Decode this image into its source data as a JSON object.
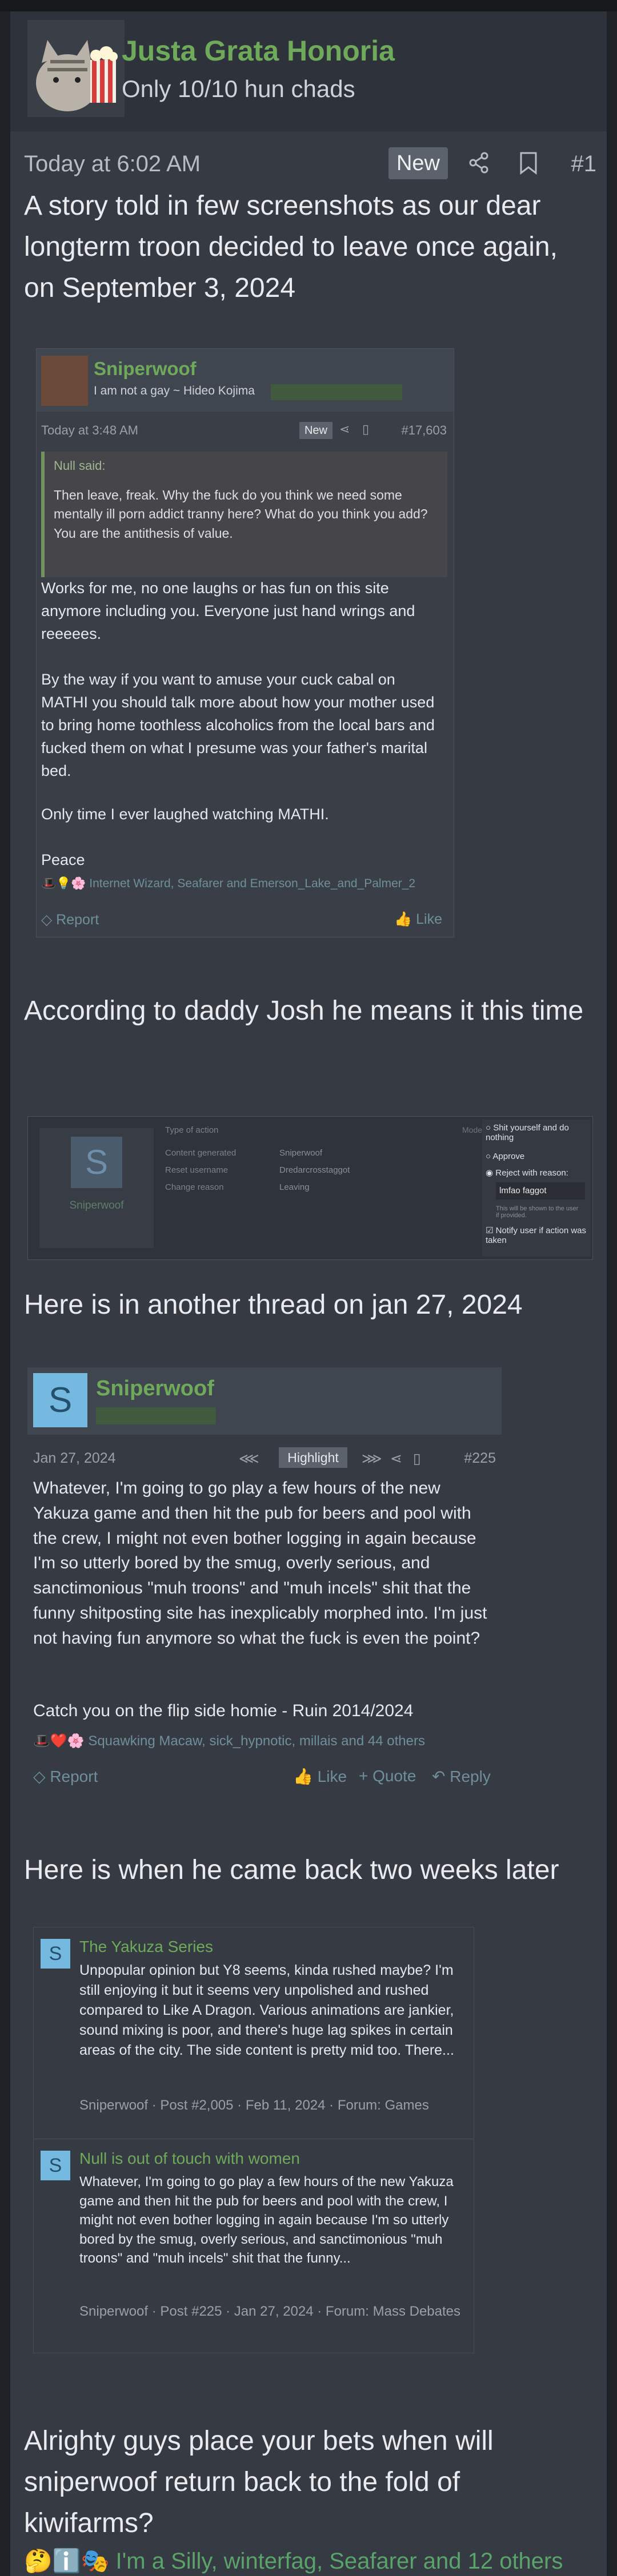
{
  "header": {
    "username": "Justa Grata Honoria",
    "user_title": "Only 10/10 hun chads",
    "timestamp": "Today at 6:02 AM",
    "badge": "New",
    "post_number": "#1",
    "icons": [
      "share-icon",
      "bookmark-icon"
    ]
  },
  "post": {
    "intro": "A story told in few screenshots as our dear longterm troon decided to leave once again, on September 3, 2024",
    "caption2": "According to daddy Josh he means it this time",
    "caption3": "Here is in another thread on jan 27, 2024",
    "caption4": "Here is when he came back two weeks later",
    "outro": "Alrighty guys place your bets when will sniperwoof return back to the fold of kiwifarms?",
    "reactions": "I'm a Silly, winterfag, Seafarer and 12 others"
  },
  "shot1": {
    "username": "Sniperwoof",
    "title": "I am not a gay ~ Hideo Kojima",
    "timestamp": "Today at 3:48 AM",
    "badge": "New",
    "post_number": "#17,603",
    "quote_label": "Null said:",
    "quote_text": "Then leave, freak. Why the fuck do you think we need some mentally ill porn addict tranny here? What do you think you add? You are the antithesis of value.",
    "para1": "Works for me, no one laughs or has fun on this site anymore including you. Everyone just hand wrings and reeeees.",
    "para2": "By the way if you want to amuse your cuck cabal on MATHI you should talk more about how your mother used to bring home toothless alcoholics from the local bars and fucked them on what I presume was your father's marital bed.",
    "para3": "Only time I ever laughed watching MATHI.",
    "para4": "Peace",
    "reactions": "Internet Wizard, Seafarer and Emerson_Lake_and_Palmer_2",
    "report": "Report",
    "like": "Like"
  },
  "shot2": {
    "avatar_letter": "S",
    "username": "Sniperwoof",
    "rows": [
      {
        "label": "Type of action",
        "value": ""
      },
      {
        "label": "Content generated",
        "value": "Sniperwoof"
      },
      {
        "label": "Reset username",
        "value": "Dredarcrosstaggot"
      },
      {
        "label": "Change reason",
        "value": "Leaving"
      }
    ],
    "right_header": "Moderate action",
    "options": [
      {
        "label": "Shit yourself and do nothing",
        "checked": false
      },
      {
        "label": "Approve",
        "checked": false
      },
      {
        "label": "Reject with reason:",
        "checked": true
      }
    ],
    "reason_value": "lmfao faggot",
    "note": "This will be shown to the user if provided.",
    "notify": "Notify user if action was taken"
  },
  "shot3": {
    "avatar_letter": "S",
    "username": "Sniperwoof",
    "timestamp": "Jan 27, 2024",
    "highlight": "Highlight",
    "post_number": "#225",
    "para1": "Whatever, I'm going to go play a few hours of the new Yakuza game and then hit the pub for beers and pool with the crew, I might not even bother logging in again because I'm so utterly bored by the smug, overly serious, and sanctimonious \"muh troons\" and \"muh incels\" shit that the funny shitposting site has inexplicably morphed into. I'm just not having fun anymore so what the fuck is even the point?",
    "para2": "Catch you on the flip side homie - Ruin 2014/2024",
    "reactions": "Squawking Macaw, sick_hypnotic, millais and 44 others",
    "report": "Report",
    "like": "Like",
    "quote": "+ Quote",
    "reply": "Reply"
  },
  "shot4": {
    "results": [
      {
        "avatar_letter": "S",
        "title": "The Yakuza Series",
        "snippet": "Unpopular opinion but Y8 seems, kinda rushed maybe? I'm still enjoying it but it seems very unpolished and rushed compared to Like A Dragon. Various animations are jankier, sound mixing is poor, and there's huge lag spikes in certain areas of the city. The side content is pretty mid too. There...",
        "meta": "Sniperwoof · Post #2,005 · Feb 11, 2024 · Forum: Games"
      },
      {
        "avatar_letter": "S",
        "title": "Null is out of touch with women",
        "snippet": "Whatever, I'm going to go play a few hours of the new Yakuza game and then hit the pub for beers and pool with the crew, I might not even bother logging in again because I'm so utterly bored by the smug, overly serious, and sanctimonious \"muh troons\" and \"muh incels\" shit that the funny...",
        "meta": "Sniperwoof · Post #225 · Jan 27, 2024 · Forum: Mass Debates"
      }
    ]
  },
  "colors": {
    "username_green": "#6faa5b",
    "background": "#353a43",
    "header": "#2e333b",
    "link_blue": "#5b8fb0"
  }
}
